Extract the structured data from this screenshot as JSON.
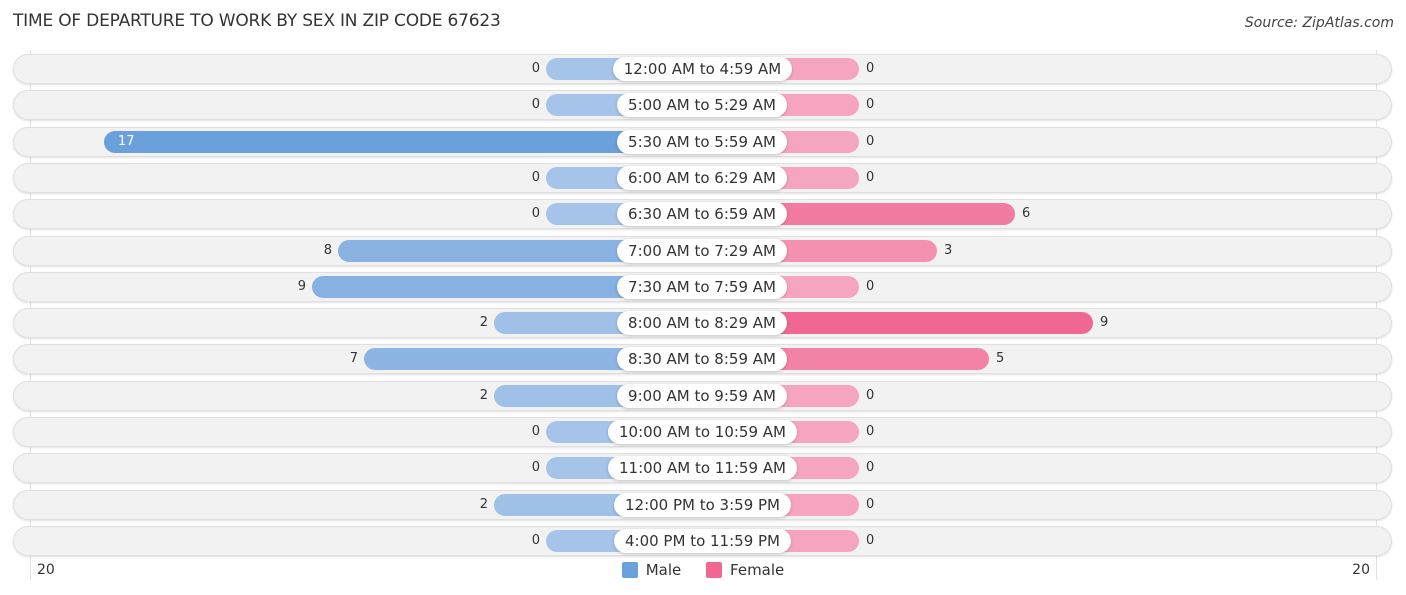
{
  "header": {
    "title": "TIME OF DEPARTURE TO WORK BY SEX IN ZIP CODE 67623",
    "source": "Source: ZipAtlas.com"
  },
  "colors": {
    "male": "#6aa0dc",
    "male_light": "#a6c4e9",
    "female": "#f06892",
    "female_light": "#f6a5c0"
  },
  "chart_data": {
    "type": "bar",
    "orientation": "horizontal-diverging",
    "title": "TIME OF DEPARTURE TO WORK BY SEX IN ZIP CODE 67623",
    "xlabel": "",
    "ylabel": "",
    "xlim": [
      -20,
      20
    ],
    "axis_tick_labels": {
      "left": "20",
      "right": "20"
    },
    "legend": {
      "position": "bottom-center",
      "entries": [
        "Male",
        "Female"
      ]
    },
    "categories": [
      "12:00 AM to 4:59 AM",
      "5:00 AM to 5:29 AM",
      "5:30 AM to 5:59 AM",
      "6:00 AM to 6:29 AM",
      "6:30 AM to 6:59 AM",
      "7:00 AM to 7:29 AM",
      "7:30 AM to 7:59 AM",
      "8:00 AM to 8:29 AM",
      "8:30 AM to 8:59 AM",
      "9:00 AM to 9:59 AM",
      "10:00 AM to 10:59 AM",
      "11:00 AM to 11:59 AM",
      "12:00 PM to 3:59 PM",
      "4:00 PM to 11:59 PM"
    ],
    "series": [
      {
        "name": "Male",
        "values": [
          0,
          0,
          17,
          0,
          0,
          8,
          9,
          2,
          7,
          2,
          0,
          0,
          2,
          0
        ]
      },
      {
        "name": "Female",
        "values": [
          0,
          0,
          0,
          0,
          6,
          3,
          0,
          9,
          5,
          0,
          0,
          0,
          0,
          0
        ]
      }
    ]
  }
}
